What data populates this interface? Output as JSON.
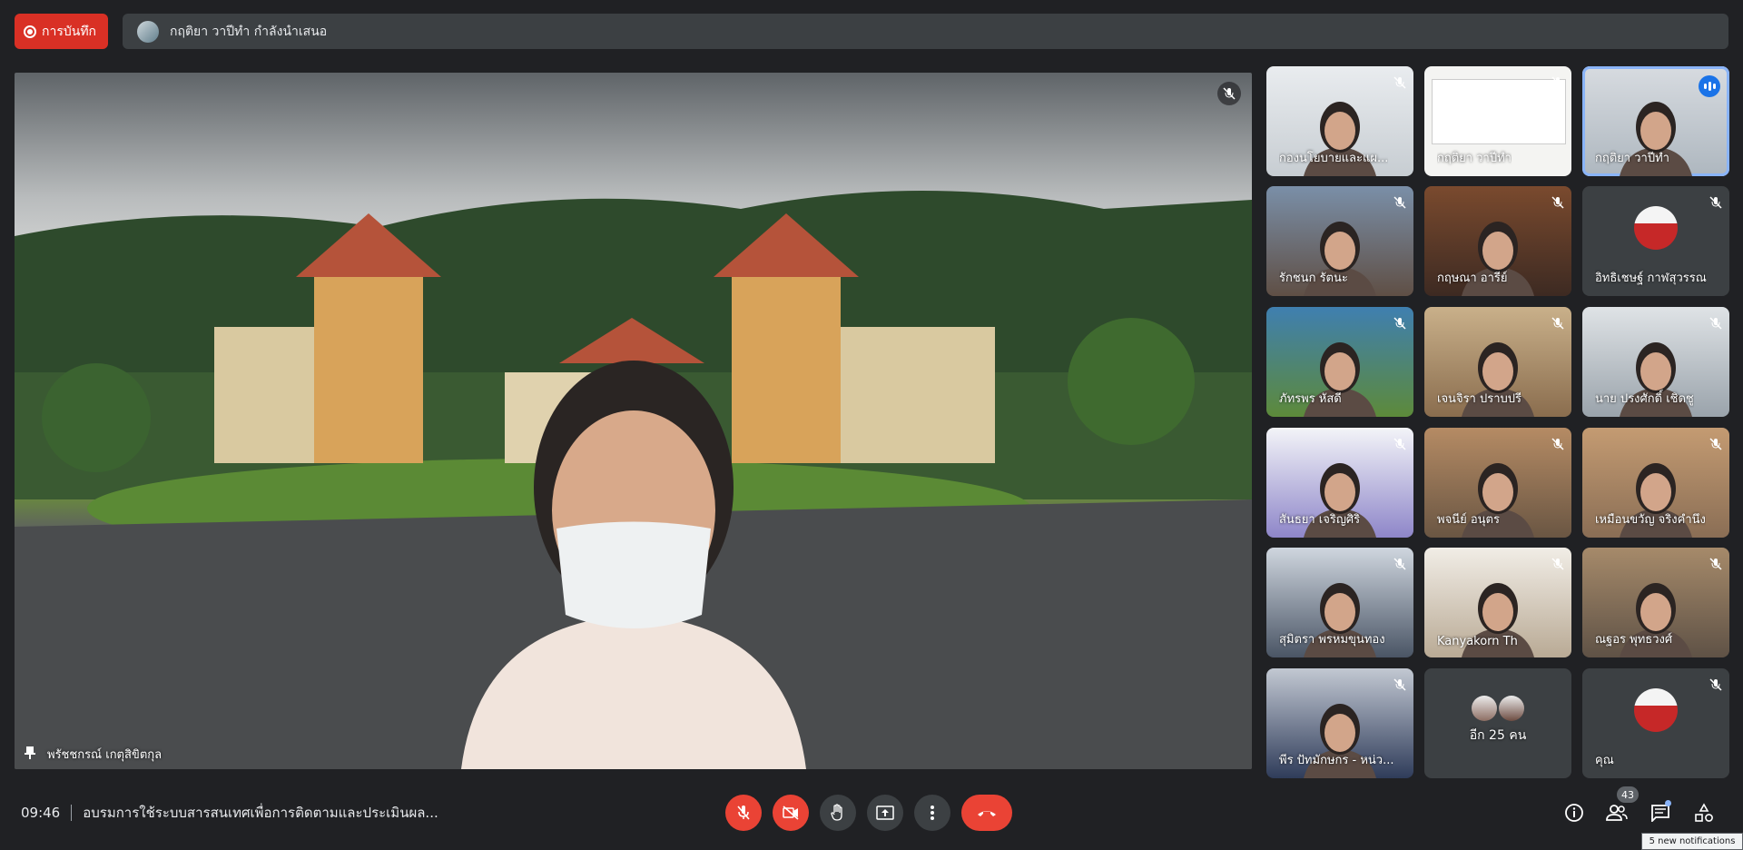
{
  "recording": {
    "label": "การบันทึก"
  },
  "presenting": {
    "text": "กฤติยา วาปีทำ กำลังนำเสนอ"
  },
  "main_video": {
    "name": "พรัชชกรณ์ เกตุสิขิตกุล"
  },
  "participants": [
    {
      "name": "กองนโยบายและแผ..."
    },
    {
      "name": "กฤติยา วาปีทำ"
    },
    {
      "name": "กฤติยา วาปีทำ"
    },
    {
      "name": "รักชนก รัตนะ"
    },
    {
      "name": "กฤษณา อารีย์"
    },
    {
      "name": "อิทธิเชษฐ์ กาฬสุวรรณ"
    },
    {
      "name": "ภัทรพร หัสดี"
    },
    {
      "name": "เจนจิรา ปราบปรี"
    },
    {
      "name": "นาย ปรงศักดิ์ เชิดชู"
    },
    {
      "name": "สันธยา เจริญศิริ"
    },
    {
      "name": "พจนีย์ อนุตร"
    },
    {
      "name": "เหมือนขวัญ จริงคำนึง"
    },
    {
      "name": "สุมิตรา พรหมขุนทอง"
    },
    {
      "name": "Kanyakorn Th"
    },
    {
      "name": "ณฐอร พุทธวงศ์"
    },
    {
      "name": "พีร ปัทมักษกร - หน่ว..."
    },
    {
      "name": "อีก 25 คน"
    },
    {
      "name": "คุณ"
    }
  ],
  "bottom": {
    "time": "09:46",
    "meeting_title": "อบรมการใช้ระบบสารสนเทศเพื่อการติดตามและประเมินผล...",
    "people_count": "43",
    "tooltip": "5 new notifications"
  },
  "colors": {
    "accent": "#8ab4f8",
    "end_call": "#ea4335",
    "record": "#d93025",
    "bg": "#202124"
  }
}
